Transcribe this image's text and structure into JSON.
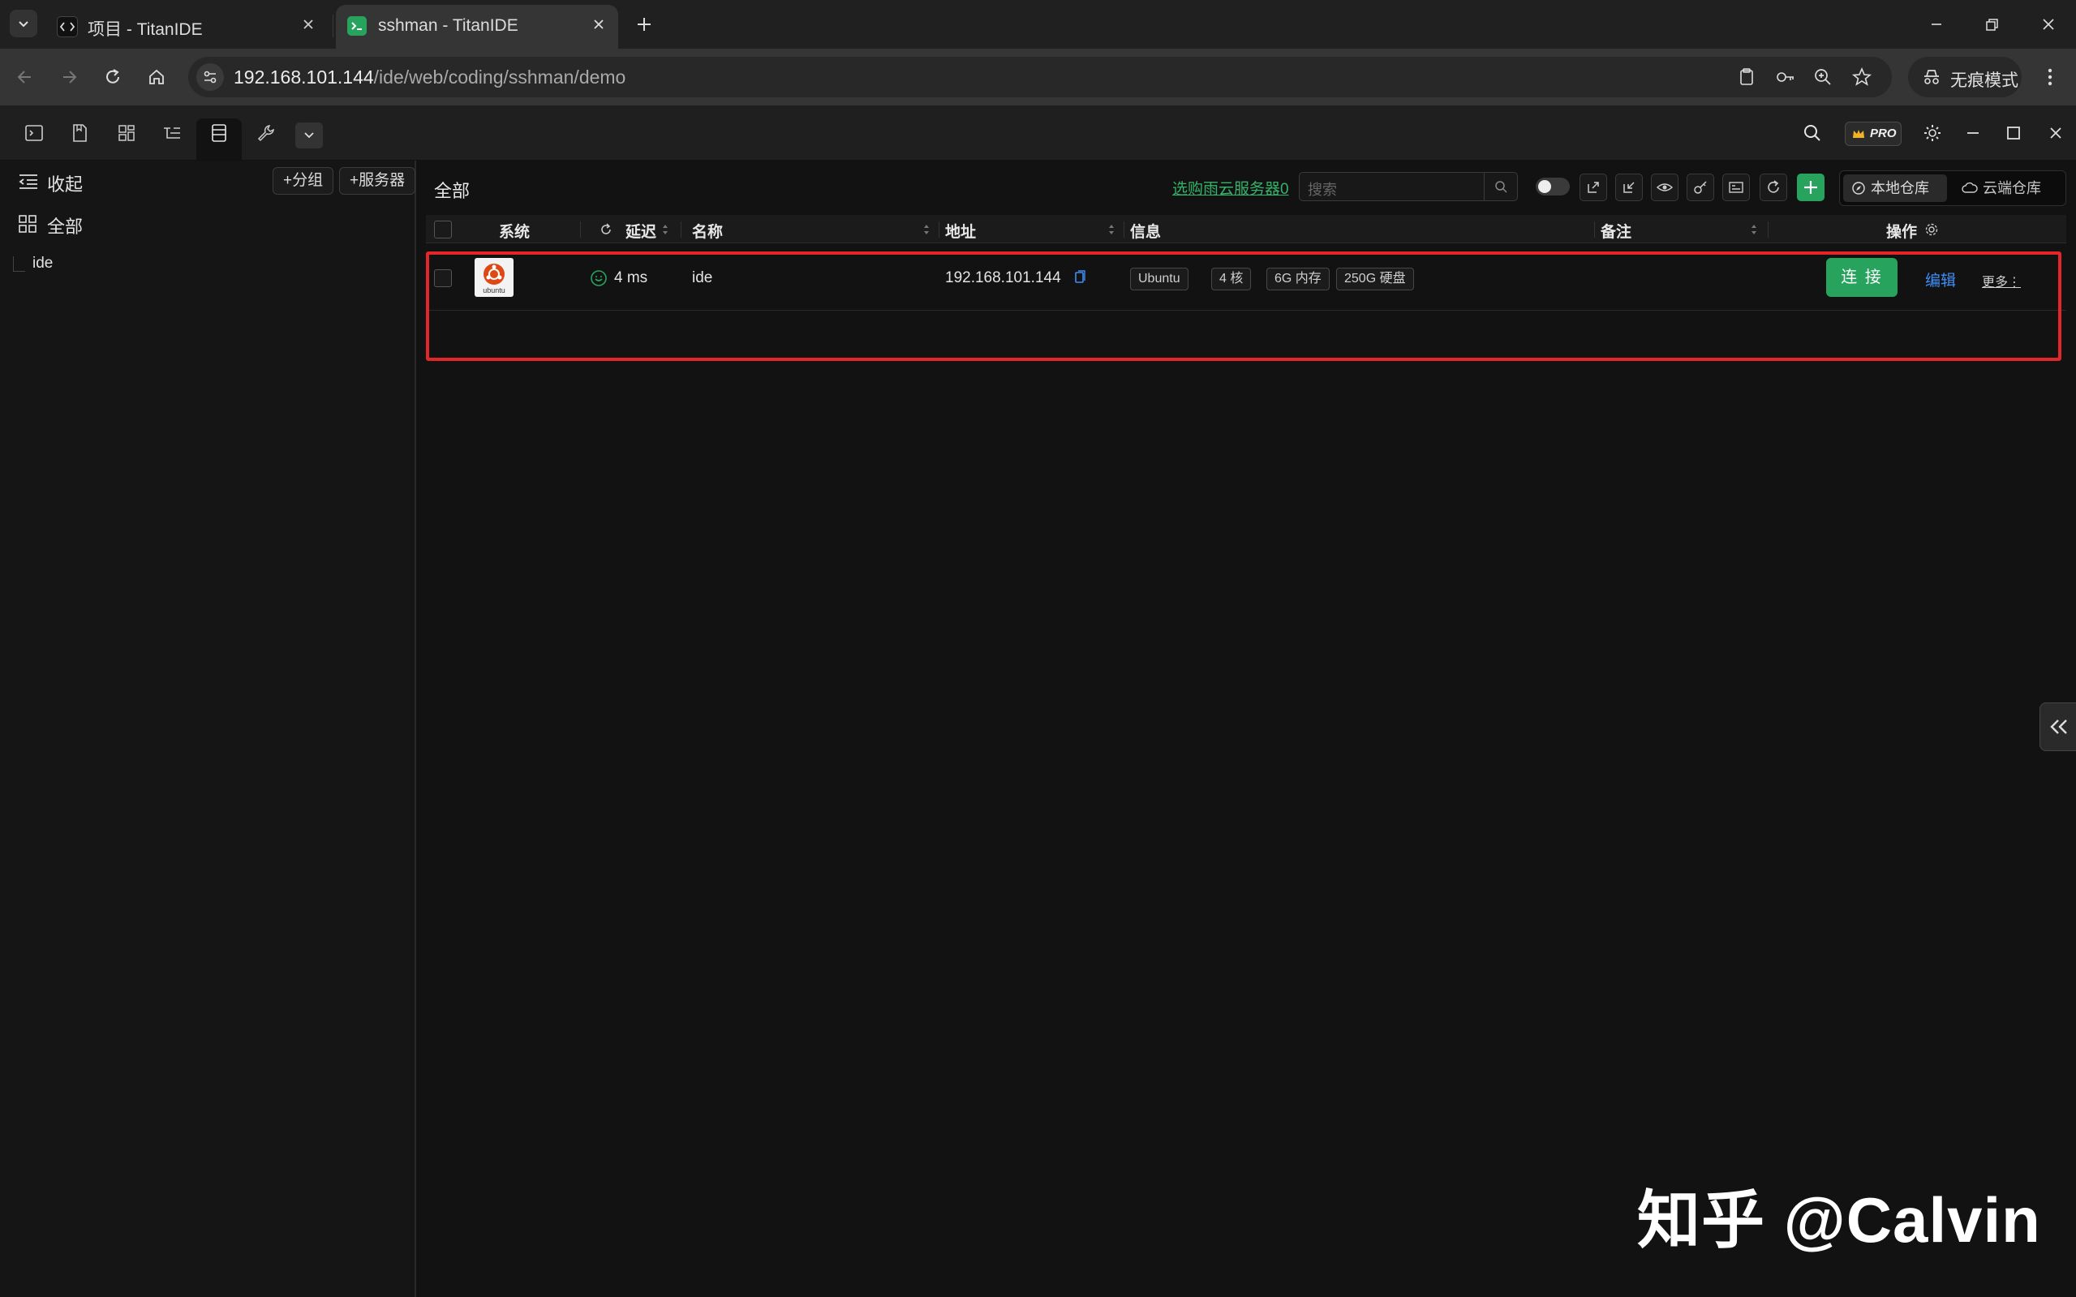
{
  "browser": {
    "tabs": [
      {
        "title": "项目 - TitanIDE",
        "active": false
      },
      {
        "title": "sshman - TitanIDE",
        "active": true
      }
    ],
    "url": {
      "host": "192.168.101.144",
      "path": "/ide/web/coding/sshman/demo"
    },
    "incognito_label": "无痕模式"
  },
  "ide": {
    "toolbar_icons": [
      "terminal-icon",
      "file-icon",
      "dashboard-icon",
      "tree-icon",
      "server-list-icon",
      "wrench-icon"
    ],
    "pro_badge": "PRO"
  },
  "sidebar": {
    "collapse_label": "收起",
    "add_group_label": "+分组",
    "add_server_label": "+服务器",
    "all_label": "全部",
    "groups": [
      {
        "name": "ide"
      }
    ]
  },
  "main": {
    "title": "全部",
    "buy_link": "选购雨云服务器0",
    "search_placeholder": "搜索",
    "repo_tabs": [
      {
        "label": "本地仓库",
        "active": true
      },
      {
        "label": "云端仓库",
        "active": false
      }
    ],
    "table": {
      "headers": {
        "system": "系统",
        "latency": "延迟",
        "name": "名称",
        "address": "地址",
        "info": "信息",
        "remark": "备注",
        "actions": "操作"
      },
      "rows": [
        {
          "os": "ubuntu",
          "latency": "4 ms",
          "name": "ide",
          "address": "192.168.101.144",
          "tags": [
            "Ubuntu",
            "4 核",
            "6G 内存",
            "250G 硬盘"
          ],
          "remark": "",
          "connect_label": "连 接",
          "edit_label": "编辑",
          "more_label": "更多⋮"
        }
      ]
    }
  },
  "watermark": "知乎 @Calvin",
  "colors": {
    "accent_green": "#27a35e",
    "link_blue": "#3f8ef5",
    "highlight_red": "#e3262a"
  }
}
